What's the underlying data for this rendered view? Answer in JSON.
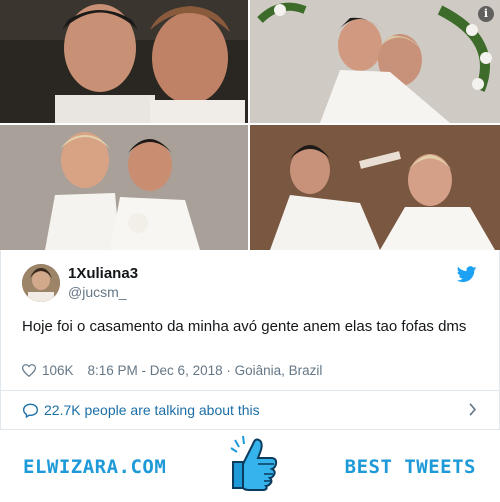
{
  "tweet": {
    "author_name": "1Xuliana3",
    "author_handle": "@jucsm_",
    "text": "Hoje foi o casamento da minha avó gente anem elas tao fofas dms",
    "likes": "106K",
    "timestamp": "8:16 PM - Dec 6, 2018 · Goiânia, Brazil",
    "talking_label": "22.7K people are talking about this",
    "photos_info_label": "i"
  },
  "banner": {
    "left_text": "ELWIZARA.COM",
    "right_text": "BEST TWEETS"
  },
  "colors": {
    "twitter_blue": "#1da1f2",
    "link_blue": "#1b6ea7",
    "banner_blue": "#1e9ad8",
    "muted_gray": "#657786"
  },
  "icons": [
    "info-icon",
    "twitter-bird-icon",
    "heart-icon",
    "speech-bubble-icon",
    "chevron-right-icon",
    "thumbs-up-icon"
  ]
}
